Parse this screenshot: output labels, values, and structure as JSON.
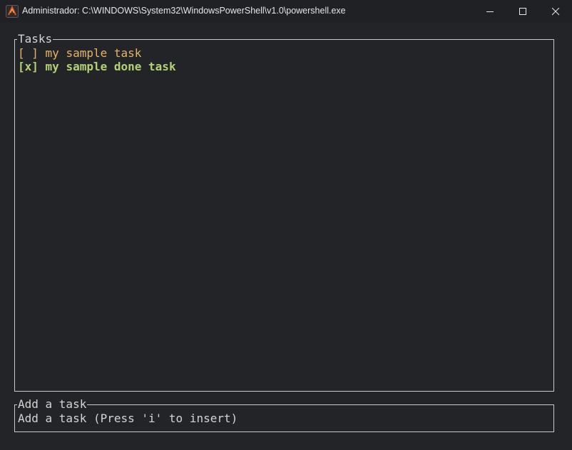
{
  "window": {
    "title": "Administrador: C:\\WINDOWS\\System32\\WindowsPowerShell\\v1.0\\powershell.exe",
    "icon": "powershell-app-icon",
    "controls": [
      "minimize-icon",
      "maximize-icon",
      "close-icon"
    ]
  },
  "tasks_panel": {
    "title": "Tasks",
    "items": [
      {
        "checkbox": "[ ]",
        "text": "my sample task",
        "done": false,
        "color": "#e5b567"
      },
      {
        "checkbox": "[x]",
        "text": "my sample done task",
        "done": true,
        "color": "#b4d273"
      }
    ]
  },
  "input_panel": {
    "title": "Add a task",
    "placeholder": "Add a task (Press 'i' to insert)"
  },
  "colors": {
    "background": "#232427",
    "border": "#c9c9c9",
    "text": "#d4d4d4"
  }
}
